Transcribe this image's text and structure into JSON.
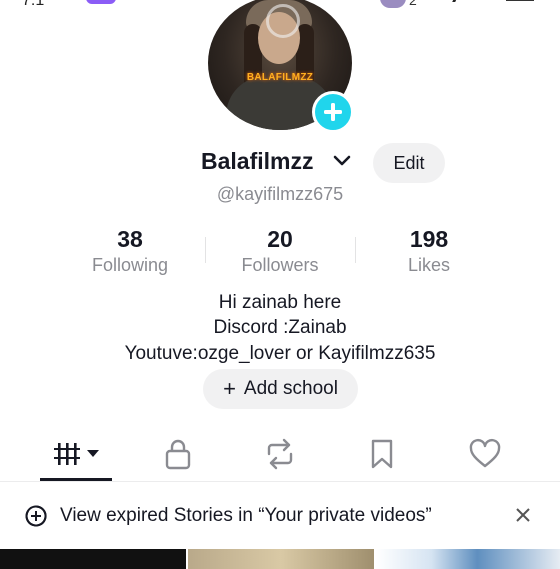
{
  "status": {
    "time_fragment": "7:1",
    "notification_count": "2"
  },
  "profile": {
    "avatar_watermark": "BALAFILMZZ",
    "username": "Balafilmzz",
    "handle": "@kayifilmzz675",
    "edit_label": "Edit"
  },
  "stats": [
    {
      "value": "38",
      "label": "Following"
    },
    {
      "value": "20",
      "label": "Followers"
    },
    {
      "value": "198",
      "label": "Likes"
    }
  ],
  "bio": {
    "line1": "Hi zainab here",
    "line2": "Discord :Zainab",
    "line3": "Youtuve:ozge_lover or Kayifilmzz635"
  },
  "school_button": {
    "icon": "+",
    "label": "Add school"
  },
  "tabs": [
    {
      "name": "videos",
      "icon": "grid-bars-icon",
      "active": true
    },
    {
      "name": "private",
      "icon": "lock-icon"
    },
    {
      "name": "reposts",
      "icon": "repost-icon"
    },
    {
      "name": "favorites",
      "icon": "bookmark-icon"
    },
    {
      "name": "liked",
      "icon": "heart-icon"
    }
  ],
  "banner": {
    "text": "View expired Stories in “Your private videos”"
  },
  "colors": {
    "accent": "#20d5ec",
    "text": "#161823",
    "muted": "#8a8b91",
    "button_bg": "#f1f1f2"
  }
}
